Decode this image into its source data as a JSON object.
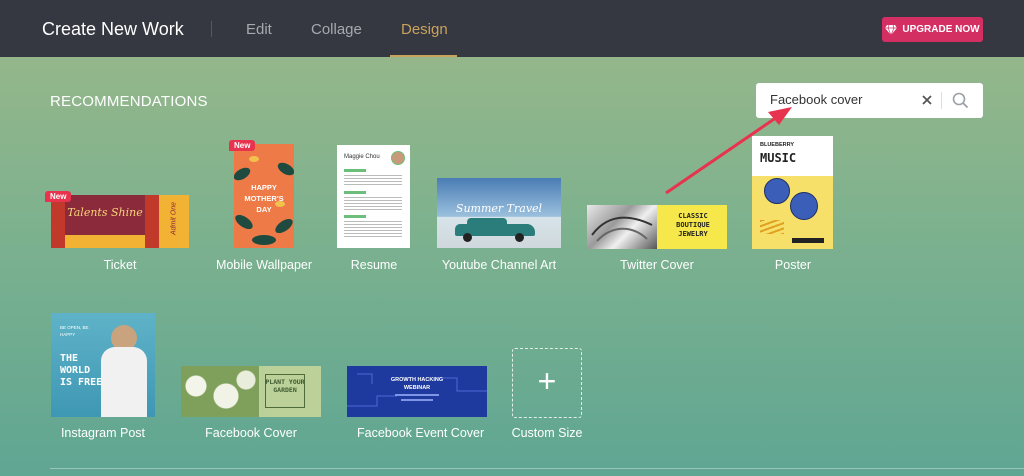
{
  "header": {
    "title": "Create New Work",
    "tabs": [
      {
        "label": "Edit"
      },
      {
        "label": "Collage"
      },
      {
        "label": "Design"
      }
    ],
    "upgrade_label": "UPGRADE NOW"
  },
  "main": {
    "section_title": "RECOMMENDATIONS",
    "search": {
      "value": "Facebook cover"
    },
    "new_badge": "New",
    "items": [
      {
        "label": "Ticket",
        "thumb_text": "Talents Shine",
        "thumb_side": "Admit One"
      },
      {
        "label": "Mobile Wallpaper",
        "thumb_text": "HAPPY MOTHER'S DAY"
      },
      {
        "label": "Resume",
        "thumb_text": "Maggie Chou"
      },
      {
        "label": "Youtube Channel Art",
        "thumb_text": "Summer Travel"
      },
      {
        "label": "Twitter Cover",
        "thumb_text": "CLASSIC BOUTIQUE JEWELRY"
      },
      {
        "label": "Poster",
        "thumb_text_top": "BLUEBERRY",
        "thumb_text": "MUSIC"
      },
      {
        "label": "Instagram Post",
        "thumb_text_top": "BE OPEN, BE HAPPY",
        "thumb_text": "THE WORLD IS FREE"
      },
      {
        "label": "Facebook Cover",
        "thumb_text": "PLANT YOUR GARDEN"
      },
      {
        "label": "Facebook Event Cover",
        "thumb_text": "GROWTH HACKING WEBINAR"
      },
      {
        "label": "Custom Size"
      }
    ]
  },
  "colors": {
    "topbar": "#353841",
    "accent": "#c9a25c",
    "upgrade": "#d42f63",
    "arrow": "#e8334f"
  }
}
